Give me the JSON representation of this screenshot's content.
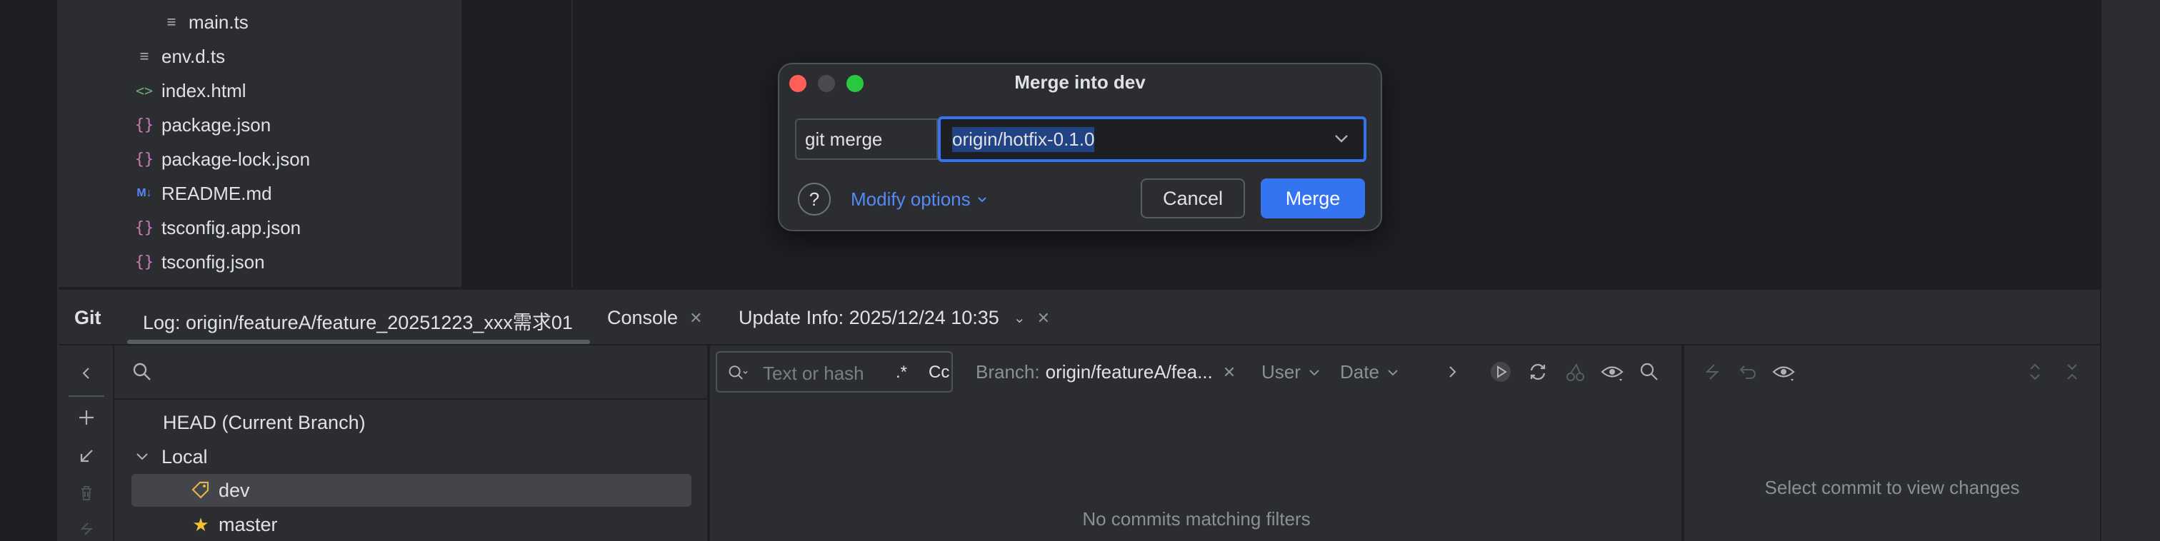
{
  "project_tree": {
    "files": [
      {
        "name": "main.ts",
        "icon": "text-file-icon"
      },
      {
        "name": "env.d.ts",
        "icon": "text-file-icon"
      },
      {
        "name": "index.html",
        "icon": "html-file-icon"
      },
      {
        "name": "package.json",
        "icon": "json-file-icon"
      },
      {
        "name": "package-lock.json",
        "icon": "json-file-icon"
      },
      {
        "name": "README.md",
        "icon": "markdown-file-icon"
      },
      {
        "name": "tsconfig.app.json",
        "icon": "json-file-icon"
      },
      {
        "name": "tsconfig.json",
        "icon": "json-file-icon"
      }
    ],
    "glyphs": {
      "text": "≡",
      "html": "<>",
      "json": "{}",
      "md": "M↓"
    }
  },
  "dialog": {
    "title": "Merge into dev",
    "command_label": "git merge",
    "branch_value": "origin/hotfix-0.1.0",
    "help_label": "?",
    "modify_options_label": "Modify options",
    "cancel_label": "Cancel",
    "merge_label": "Merge"
  },
  "tool_window": {
    "title": "Git",
    "tabs": [
      {
        "label": "Log: origin/featureA/feature_20251223_xxx需求01"
      },
      {
        "label": "Console"
      },
      {
        "label": "Update Info: 2025/12/24 10:35"
      }
    ]
  },
  "branches": {
    "head_label": "HEAD (Current Branch)",
    "local_label": "Local",
    "items": [
      {
        "name": "dev",
        "selected": true,
        "icon": "tag-icon"
      },
      {
        "name": "master",
        "selected": false,
        "icon": "star-icon"
      }
    ]
  },
  "log": {
    "filter_placeholder": "Text or hash",
    "regex_label": ".*",
    "case_label": "Cc",
    "branch_filter_label": "Branch:",
    "branch_filter_value": "origin/featureA/fea...",
    "user_filter_label": "User",
    "date_filter_label": "Date",
    "empty_message": "No commits matching filters"
  },
  "changes": {
    "empty_message": "Select commit to view changes"
  },
  "colors": {
    "accent": "#3574f0",
    "link": "#548af7",
    "panel_bg": "#2b2d30",
    "editor_bg": "#1e1f22"
  }
}
